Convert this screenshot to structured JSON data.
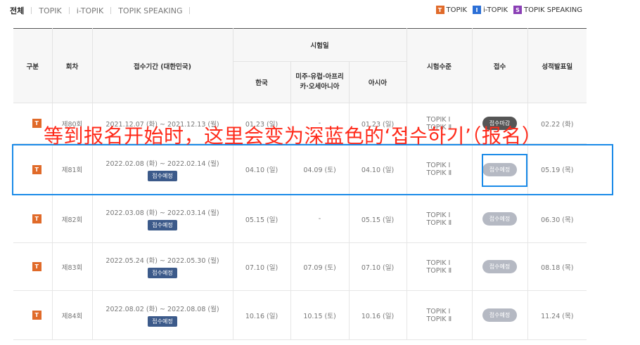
{
  "tabs": [
    {
      "label": "전체",
      "active": true
    },
    {
      "label": "TOPIK",
      "active": false
    },
    {
      "label": "i-TOPIK",
      "active": false
    },
    {
      "label": "TOPIK SPEAKING",
      "active": false
    }
  ],
  "legend": [
    {
      "badge": "T",
      "label": "TOPIK",
      "color": "#e06a29"
    },
    {
      "badge": "I",
      "label": "i-TOPIK",
      "color": "#2b6fd6"
    },
    {
      "badge": "S",
      "label": "TOPIK SPEAKING",
      "color": "#8a3fb5"
    }
  ],
  "table": {
    "headers": {
      "category": "구분",
      "round": "회차",
      "period": "접수기간 (대한민국)",
      "exam_date": "시험일",
      "korea": "한국",
      "americas": "미주·유럽·아프리카·오세아니아",
      "asia": "아시아",
      "level": "시험수준",
      "register": "접수",
      "result": "성적발표일"
    },
    "rows": [
      {
        "type": "T",
        "round": "제80회",
        "period": "2021.12.07 (화) ~ 2021.12.13 (월)",
        "period_badge": "",
        "korea": "01.23 (일)",
        "americas": "-",
        "asia": "01.23 (일)",
        "level1": "TOPIK Ⅰ",
        "level2": "TOPIK Ⅱ",
        "status": "접수마감",
        "status_style": "dark",
        "result": "02.22 (화)"
      },
      {
        "type": "T",
        "round": "제81회",
        "period": "2022.02.08 (화) ~ 2022.02.14 (월)",
        "period_badge": "접수예정",
        "korea": "04.10 (일)",
        "americas": "04.09 (토)",
        "asia": "04.10 (일)",
        "level1": "TOPIK Ⅰ",
        "level2": "TOPIK Ⅱ",
        "status": "접수예정",
        "status_style": "grey",
        "result": "05.19 (목)"
      },
      {
        "type": "T",
        "round": "제82회",
        "period": "2022.03.08 (화) ~ 2022.03.14 (월)",
        "period_badge": "접수예정",
        "korea": "05.15 (일)",
        "americas": "-",
        "asia": "05.15 (일)",
        "level1": "TOPIK Ⅰ",
        "level2": "TOPIK Ⅱ",
        "status": "접수예정",
        "status_style": "grey",
        "result": "06.30 (목)"
      },
      {
        "type": "T",
        "round": "제83회",
        "period": "2022.05.24 (화) ~ 2022.05.30 (월)",
        "period_badge": "접수예정",
        "korea": "07.10 (일)",
        "americas": "07.09 (토)",
        "asia": "07.10 (일)",
        "level1": "TOPIK Ⅰ",
        "level2": "TOPIK Ⅱ",
        "status": "접수예정",
        "status_style": "grey",
        "result": "08.18 (목)"
      },
      {
        "type": "T",
        "round": "제84회",
        "period": "2022.08.02 (화) ~ 2022.08.08 (월)",
        "period_badge": "접수예정",
        "korea": "10.16 (일)",
        "americas": "10.15 (토)",
        "asia": "10.16 (일)",
        "level1": "TOPIK Ⅰ",
        "level2": "TOPIK Ⅱ",
        "status": "접수예정",
        "status_style": "grey",
        "result": "11.24 (목)"
      }
    ]
  },
  "annotation": {
    "text": "等到报名开始时，这里会变为深蓝色的‘접수하기’（报名）",
    "color": "#ff2a1a",
    "box_color": "#1a8ae8"
  }
}
